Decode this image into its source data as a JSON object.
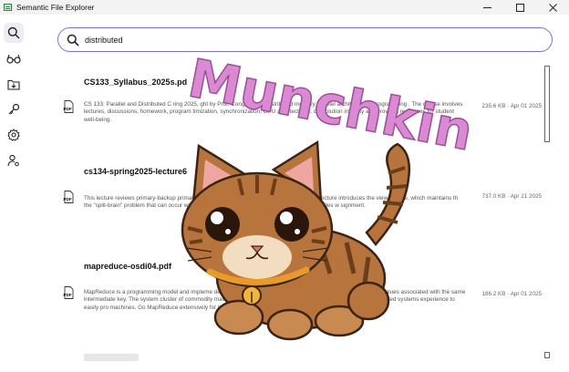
{
  "window": {
    "title": "Semantic File Explorer",
    "icon": "app-icon"
  },
  "sidebar": {
    "items": [
      {
        "name": "search",
        "icon": "search-icon",
        "active": true
      },
      {
        "name": "glasses",
        "icon": "glasses-icon",
        "active": false
      },
      {
        "name": "import",
        "icon": "folder-import-icon",
        "active": false
      },
      {
        "name": "key",
        "icon": "key-icon",
        "active": false
      },
      {
        "name": "settings",
        "icon": "gear-icon",
        "active": false
      },
      {
        "name": "user-settings",
        "icon": "user-gear-icon",
        "active": false
      }
    ]
  },
  "search": {
    "value": "distributed",
    "accent_color": "#7a71d8"
  },
  "results": [
    {
      "title": "CS133_Syllabus_2025s.pd",
      "description": "CS 133: Parallel and Distributed C                         ring 2025,          ght by Prof. Cong, cov          nd distributed memory parallel architectures, programming                                                      . The course involves lectures, discussions, homework, program                               timization, synchronization, GPU architectures, convolution                                                   integrity and provides resources for student well-being.",
      "size": "235.6 KB",
      "date": "Apr 01 2025"
    },
    {
      "title": "cs134-spring2025-lecture6",
      "description": "This lecture reviews primary-backup                                                         primary-backup ensures consistency and fault tolera                                                          he lecture introduces the view service, which maintains th                                                     the \"split-brain\" problem that can occur with netw                                                          edgements from backups. The lecture concludes w                                                          signment.",
      "size": "737.0 KB",
      "date": "Apr 21 2025"
    },
    {
      "title": "mapreduce-osdi04.pdf",
      "description": "MapReduce is a programming model and impleme                                                    define a `Map` function to process key/value pairs and generate                                                 e values associated with the same intermediate key. The system                                                  cluster of commodity machines, handling partitioning, scheduling                                                rammers without distributed systems experience to easily pro                    machines. Go          MapReduce extensively for tasks like indexing, data mining, and machine learning.",
      "size": "186.2 KB",
      "date": "Apr 01 2025"
    }
  ],
  "file_type_label": "PDF",
  "separator": "·",
  "sticker": {
    "text": "Munchkin",
    "text_color": "#d98ad3",
    "cat_color": "#b8743d",
    "collar_color": "#e89a2a"
  }
}
